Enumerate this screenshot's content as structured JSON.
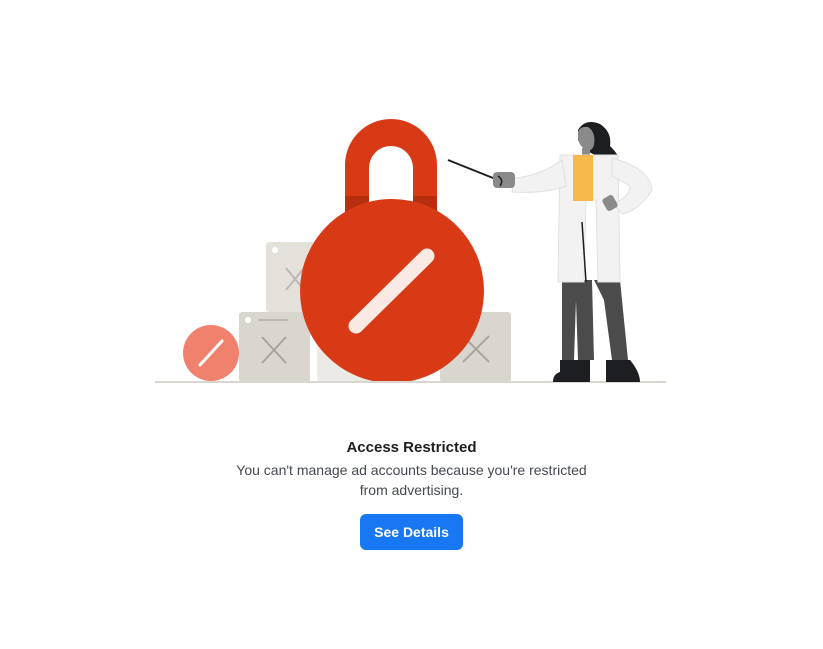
{
  "restriction_notice": {
    "title": "Access Restricted",
    "message": "You can't manage ad accounts because you're restricted from advertising.",
    "button_label": "See Details"
  },
  "colors": {
    "accent": "#1877f2",
    "lock_red": "#d83a16",
    "badge_salmon": "#f0826d",
    "box_gray": "#d9d6d0",
    "pants_gray": "#4b4b4b",
    "shirt_yellow": "#f7b84b"
  }
}
